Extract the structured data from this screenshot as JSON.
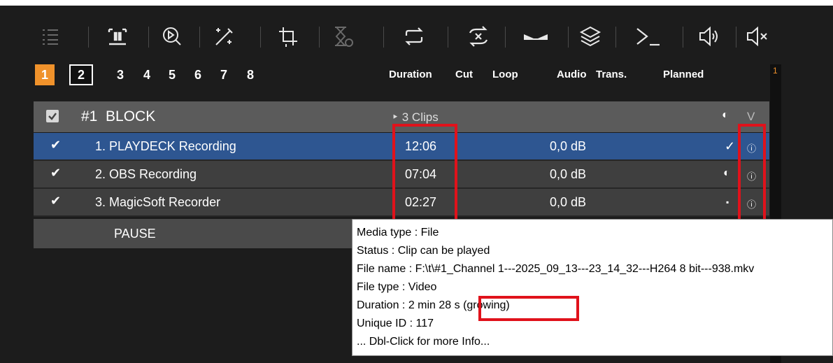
{
  "toolbar": {
    "icons": [
      "list-icon",
      "pause-clip-icon",
      "preview-icon",
      "magic-wand-icon",
      "crop-icon",
      "hourglass-timer-icon",
      "loop-icon",
      "skip-icon",
      "transition-icon",
      "layers-icon",
      "command-prompt-icon",
      "volume-icon",
      "mute-icon"
    ]
  },
  "tabs": [
    "1",
    "2",
    "3",
    "4",
    "5",
    "6",
    "7",
    "8"
  ],
  "active_tab": "1",
  "columns": {
    "duration": "Duration",
    "cut": "Cut",
    "loop": "Loop",
    "audio": "Audio",
    "trans": "Trans.",
    "planned": "Planned"
  },
  "gutter_number": "1",
  "block": {
    "title": "#1  BLOCK",
    "clips": "‣ 3 Clips"
  },
  "clips": [
    {
      "name": "1. PLAYDECK Recording",
      "duration": "12:06",
      "audio": "0,0 dB",
      "status": "✓",
      "selected": true
    },
    {
      "name": "2. OBS Recording",
      "duration": "07:04",
      "audio": "0,0 dB",
      "status": "◐",
      "selected": false
    },
    {
      "name": "3. MagicSoft Recorder",
      "duration": "02:27",
      "audio": "0,0 dB",
      "status": "▪",
      "selected": false
    }
  ],
  "pause_label": "PAUSE",
  "tooltip": {
    "media_type": "Media type : File",
    "status": "Status : Clip can be played",
    "file_name": "File name : F:\\t\\#1_Channel 1---2025_09_13---23_14_32---H264  8 bit---938.mkv",
    "file_type": "File type : Video",
    "duration": "Duration : 2 min 28 s (growing)",
    "unique_id": "Unique ID : 117",
    "more": "... Dbl-Click for more Info..."
  },
  "colors": {
    "background": "#1c1c1c",
    "selected_row": "#2e5691",
    "active_tab": "#f0922b",
    "highlight": "#e0121b"
  }
}
